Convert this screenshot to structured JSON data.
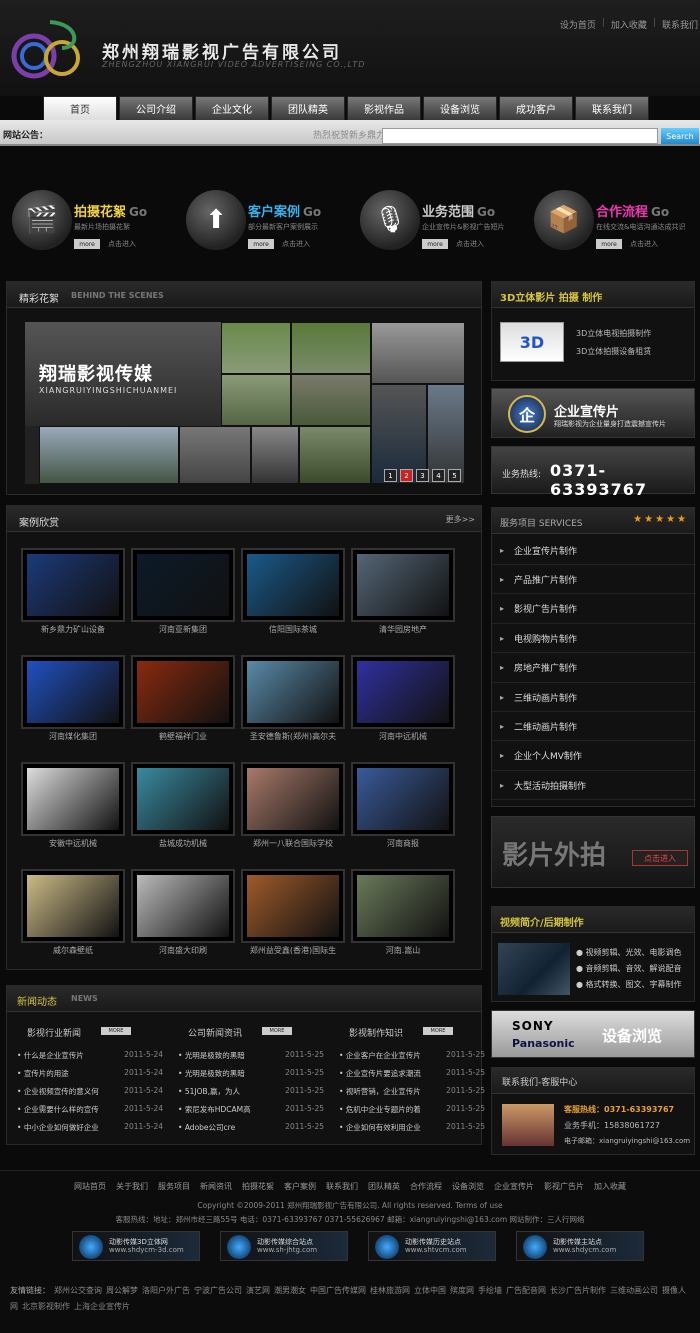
{
  "header": {
    "company_cn": "郑州翔瑞影视广告有限公司",
    "company_en": "ZHENGZHOU XIANGRUI VIDEO ADVERTISEING CO.,LTD",
    "top_links": [
      "设为首页",
      "加入收藏",
      "联系我们"
    ]
  },
  "nav": {
    "tabs": [
      "首页",
      "公司介绍",
      "企业文化",
      "团队精英",
      "影视作品",
      "设备浏览",
      "成功客户",
      "联系我们"
    ],
    "active": "首页"
  },
  "notice": {
    "label": "网站公告：",
    "hot": "热烈祝贺新乡鼎力",
    "search_value": "",
    "search_button": "Search"
  },
  "features": [
    {
      "title": "拍摄花絮",
      "go": "Go",
      "sub": "最新片场拍摄花絮",
      "more": "more",
      "enter": "点击进入",
      "color": "#f0d23a",
      "icon": "clapperboard-icon"
    },
    {
      "title": "客户案例",
      "go": "Go",
      "sub": "部分最新客户案例展示",
      "more": "more",
      "enter": "点击进入",
      "color": "#3ab0e8",
      "icon": "arrow-up-icon"
    },
    {
      "title": "业务范围",
      "go": "Go",
      "sub": "企业宣传片&影视广告短片",
      "more": "more",
      "enter": "点击进入",
      "color": "#cccccc",
      "icon": "microphone-icon"
    },
    {
      "title": "合作流程",
      "go": "Go",
      "sub": "在线交流&电话沟通达成共识",
      "more": "more",
      "enter": "点击进入",
      "color": "#e83ab0",
      "icon": "boxes-icon"
    }
  ],
  "scenes": {
    "title": "精彩花絮",
    "title_en": "BEHIND THE SCENES",
    "banner_title": "翔瑞影视传媒",
    "banner_sub": "XIANGRUIYINGSHICHUANMEI",
    "pages": [
      "1",
      "2",
      "3",
      "4",
      "5"
    ],
    "active_page": "2"
  },
  "cases": {
    "title": "案例欣赏",
    "more": "更多>>",
    "items": [
      {
        "name": "新乡鼎力矿山设备",
        "color": "#1c3a7a"
      },
      {
        "name": "河南亚新集团",
        "color": "#0c1a2a"
      },
      {
        "name": "信阳国际茶城",
        "color": "#1a5a8a"
      },
      {
        "name": "清华园房地产",
        "color": "#556677"
      },
      {
        "name": "河南煤化集团",
        "color": "#2050c0"
      },
      {
        "name": "鹤壁福祥门业",
        "color": "#8a2a10"
      },
      {
        "name": "圣安德鲁斯(郑州)高尔夫",
        "color": "#5a8aa8"
      },
      {
        "name": "河南中远机械",
        "color": "#3030a0"
      },
      {
        "name": "安徽中远机械",
        "color": "#dddddd"
      },
      {
        "name": "盐城成功机械",
        "color": "#3a8aa0"
      },
      {
        "name": "郑州一八联合国际学校",
        "color": "#a87a6a"
      },
      {
        "name": "河南商报",
        "color": "#3a5a9a"
      },
      {
        "name": "威尔森壁纸",
        "color": "#ccbb88"
      },
      {
        "name": "河南盛大印刷",
        "color": "#bbbbbb"
      },
      {
        "name": "郑州益受鑫(香港)国际生",
        "color": "#a05a2a"
      },
      {
        "name": "河南.嵩山",
        "color": "#6a7a5a"
      }
    ]
  },
  "news": {
    "title": "新闻动态",
    "title_en": "NEWS",
    "more": "MORE",
    "columns": [
      {
        "heading": "影视行业新闻",
        "items": [
          {
            "t": "什么是企业宣传片",
            "d": "2011-5-24"
          },
          {
            "t": "宣传片的用途",
            "d": "2011-5-24"
          },
          {
            "t": "企业视频宣传的意义何",
            "d": "2011-5-24"
          },
          {
            "t": "企业需要什么样的宣传",
            "d": "2011-5-24"
          },
          {
            "t": "中小企业如何做好企业",
            "d": "2011-5-24"
          }
        ]
      },
      {
        "heading": "公司新闻资讯",
        "items": [
          {
            "t": "光明是极致的黑暗",
            "d": "2011-5-25"
          },
          {
            "t": "光明是极致的黑暗",
            "d": "2011-5-25"
          },
          {
            "t": "51JOB,赢，为人",
            "d": "2011-5-25"
          },
          {
            "t": "索尼发布HDCAM高",
            "d": "2011-5-25"
          },
          {
            "t": "Adobe公司cre",
            "d": "2011-5-25"
          }
        ]
      },
      {
        "heading": "影视制作知识",
        "items": [
          {
            "t": "企业客户在企业宣传片",
            "d": "2011-5-25"
          },
          {
            "t": "企业宣传片要追求潮流",
            "d": "2011-5-25"
          },
          {
            "t": "视听营销，企业宣传片",
            "d": "2011-5-25"
          },
          {
            "t": "危机中企业专题片的着",
            "d": "2011-5-25"
          },
          {
            "t": "企业如何有效利用企业",
            "d": "2011-5-25"
          }
        ]
      }
    ]
  },
  "sidebar": {
    "s3d_title": "3D立体影片 拍摄 制作",
    "s3d_logo": "3D",
    "s3d_lines": [
      "3D立体电视拍摄制作",
      "3D立体拍摄设备租赁"
    ],
    "promo_badge": "企",
    "promo_title": "企业宣传片",
    "promo_sub": "翔瑞影视为企业量身打造震撼宣传片",
    "hotline_label": "业务热线:",
    "hotline_number": "0371-63393767",
    "services_title": "服务项目 SERVICES",
    "services": [
      "企业宣传片制作",
      "产品推广片制作",
      "影视广告片制作",
      "电视购物片制作",
      "房地产推广制作",
      "三维动画片制作",
      "二维动画片制作",
      "企业个人MV制作",
      "大型活动拍摄制作"
    ],
    "shoot_title": "影片外拍",
    "shoot_btn": "点击进入",
    "video_title": "视频简介/后期制作",
    "video_lines": [
      "视频剪辑、光效、电影调色",
      "音频剪辑、音效、解说配音",
      "格式转换、图文、字幕制作"
    ],
    "brand1": "SONY",
    "brand2": "Panasonic",
    "brands_title": "设备浏览",
    "contact_title": "联系我们-客服中心",
    "contact_hotline": "客服热线：0371-63393767",
    "contact_mobile": "业务手机：15838061727",
    "contact_email": "电子邮箱：xiangruiyingshi@163.com"
  },
  "footer": {
    "links": [
      "网站首页",
      "关于我们",
      "服务项目",
      "新闻资讯",
      "拍摄花絮",
      "客户案例",
      "联系我们",
      "团队精英",
      "合作流程",
      "设备浏览",
      "企业宣传片",
      "影视广告片",
      "加入收藏"
    ],
    "copyright": "Copyright ©2009-2011 郑州翔瑞影视广告有限公司. All rights reserved. Terms of use",
    "info": "客服热线：地址：郑州市经三路55号 电话：0371-63393767 0371-55626967 邮箱：xiangruiyingshi@163.com 网站制作：三人行网络",
    "banners": [
      {
        "name": "动影传媒3D立体网",
        "url": "www.shdycm-3d.com"
      },
      {
        "name": "动影传媒综合站点",
        "url": "www.sh-jhtg.com"
      },
      {
        "name": "动影传媒历史站点",
        "url": "www.shtvcm.com"
      },
      {
        "name": "动影传媒主站点",
        "url": "www.shdycm.com"
      }
    ],
    "friend_label": "友情链接：",
    "friend_links": [
      "郑州公交查询",
      "周公解梦",
      "洛阳户外广告",
      "宁波广告公司",
      "演艺网",
      "潮男潮女",
      "中国广告传媒网",
      "桂林旅游网",
      "立体中国",
      "殡度网",
      "手绘墙",
      "广告配音网",
      "长沙广告片制作",
      "三维动画公司",
      "摄像人网",
      "北京影视制作",
      "上海企业宣传片"
    ]
  }
}
